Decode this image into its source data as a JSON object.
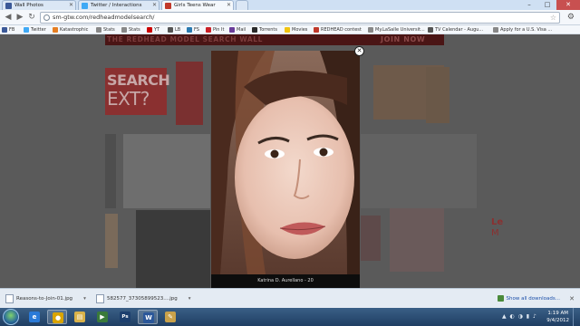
{
  "browser": {
    "tabs": [
      {
        "title": "Wall Photos",
        "color": "#3b5998"
      },
      {
        "title": "Twitter / Interactions",
        "color": "#3fa9f5"
      },
      {
        "title": "Girls Teens Wear",
        "color": "#c0392b"
      }
    ],
    "url": "sm-gtw.com/redheadmodelsearch/",
    "window_controls": [
      "–",
      "□",
      "✕"
    ],
    "bookmarks": [
      {
        "label": "FB",
        "color": "#3b5998"
      },
      {
        "label": "Twitter",
        "color": "#3fa9f5"
      },
      {
        "label": "Katastrophic",
        "color": "#e67e22"
      },
      {
        "label": "Stats",
        "color": "#888888"
      },
      {
        "label": "Stats",
        "color": "#888888"
      },
      {
        "label": "YT",
        "color": "#cc0000"
      },
      {
        "label": "LB",
        "color": "#555555"
      },
      {
        "label": "FS",
        "color": "#2a7ab0"
      },
      {
        "label": "Pin It",
        "color": "#cb2027"
      },
      {
        "label": "Mail",
        "color": "#6a3d9a"
      },
      {
        "label": "Torrents",
        "color": "#2a2a2a"
      },
      {
        "label": "Movies",
        "color": "#f1c40f"
      },
      {
        "label": "REDHEAD contest",
        "color": "#c0392b"
      },
      {
        "label": "My.LaSalle Universit...",
        "color": "#888888"
      },
      {
        "label": "TV Calendar - Augu...",
        "color": "#555555"
      },
      {
        "label": "Apply for a U.S. Visa ...",
        "color": "#888888"
      }
    ]
  },
  "page": {
    "banner_title": "THE REDHEAD MODEL SEARCH WALL",
    "banner_join": "JOIN NOW",
    "search_tile_line1": "SEARCH",
    "search_tile_line2": "EXT?",
    "side_tile_line1": "Le",
    "side_tile_line2": "M",
    "modal": {
      "caption": "Katrina D. Aurellano - 20",
      "close_symbol": "✕"
    }
  },
  "downloads": {
    "items": [
      {
        "name": "Reasons-to-Join-01.jpg"
      },
      {
        "name": "582577_37305899523....jpg"
      }
    ],
    "show_all": "Show all downloads...",
    "close_symbol": "✕"
  },
  "taskbar": {
    "apps": [
      {
        "name": "ie",
        "glyph": "e",
        "color": "#2a7ad8"
      },
      {
        "name": "chrome",
        "glyph": "●",
        "color": "#d9a400"
      },
      {
        "name": "explorer",
        "glyph": "▤",
        "color": "#d9b24a"
      },
      {
        "name": "media-player",
        "glyph": "▶",
        "color": "#3a7a3a"
      },
      {
        "name": "photoshop",
        "glyph": "Ps",
        "color": "#1c3f6e"
      },
      {
        "name": "word",
        "glyph": "W",
        "color": "#2b579a"
      },
      {
        "name": "paint",
        "glyph": "✎",
        "color": "#c9a14a"
      }
    ],
    "tray_icons": "▲ ◐ ◑ ▮ ♪",
    "time": "1:19 AM",
    "date": "9/4/2012"
  }
}
